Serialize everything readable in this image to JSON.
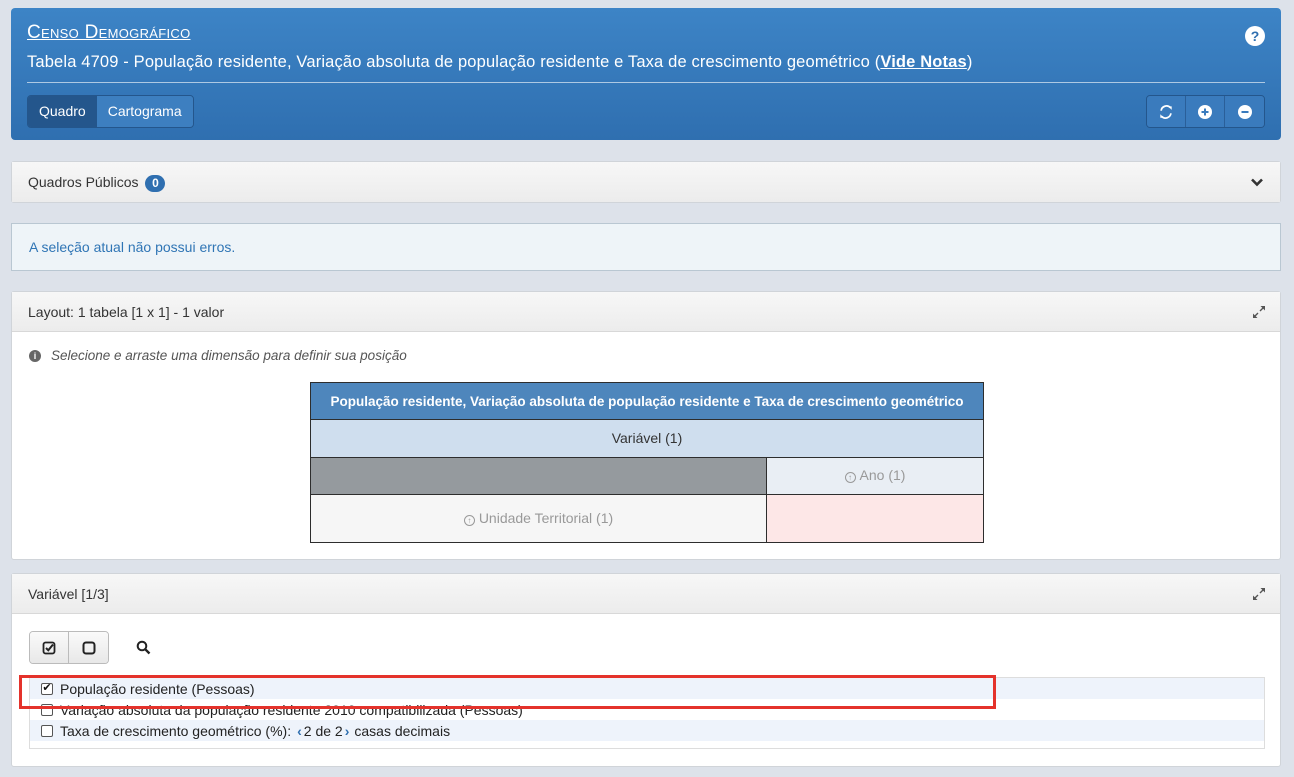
{
  "header": {
    "app_title": "Censo Demográfico",
    "table_title_prefix": "Tabela 4709 - População residente, Variação absoluta de população residente e Taxa de crescimento geométrico (",
    "notes_link": "Vide Notas",
    "table_title_suffix": ")",
    "help_icon": "?",
    "tabs": [
      {
        "label": "Quadro",
        "active": true
      },
      {
        "label": "Cartograma",
        "active": false
      }
    ],
    "tools": [
      "refresh-icon",
      "plus-circle-icon",
      "minus-circle-icon"
    ]
  },
  "public_tables": {
    "label": "Quadros Públicos",
    "count": "0"
  },
  "alert": {
    "message": "A seleção atual não possui erros."
  },
  "layout": {
    "title": "Layout: 1 tabela [1 x 1] - 1 valor",
    "hint": "Selecione e arraste uma dimensão para definir sua posição",
    "grid_title": "População residente, Variação absoluta de população residente e Taxa de crescimento geométrico",
    "variable_label": "Variável (1)",
    "year_label": "Ano (1)",
    "unit_label": "Unidade Territorial (1)"
  },
  "variables": {
    "title": "Variável [1/3]",
    "items": [
      {
        "label": "População residente (Pessoas)",
        "checked": true
      },
      {
        "label": "Variação absoluta da população residente 2010 compatibilizada (Pessoas)",
        "checked": false
      },
      {
        "label": "Taxa de crescimento geométrico (%):",
        "checked": false
      }
    ],
    "decimals": {
      "value": "2 de 2",
      "suffix": "casas decimais"
    }
  },
  "colors": {
    "header_blue": "#2f6fb0",
    "highlight_red": "#e4322b",
    "alert_text": "#2f75b5"
  }
}
